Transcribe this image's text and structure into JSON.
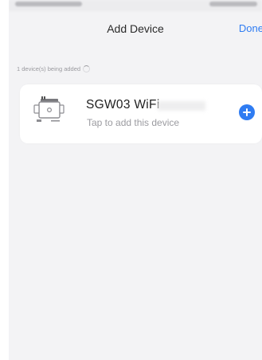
{
  "nav": {
    "title": "Add Device",
    "done_label": "Done"
  },
  "status": {
    "adding_text": "1 device(s) being added"
  },
  "device": {
    "name": "SGW03  WiFi",
    "hint": "Tap to add this device",
    "icon": "gateway-device-icon",
    "add_icon": "plus-circle-icon"
  },
  "colors": {
    "accent": "#2f7cf2",
    "background": "#f3f3f5",
    "card": "#ffffff"
  }
}
